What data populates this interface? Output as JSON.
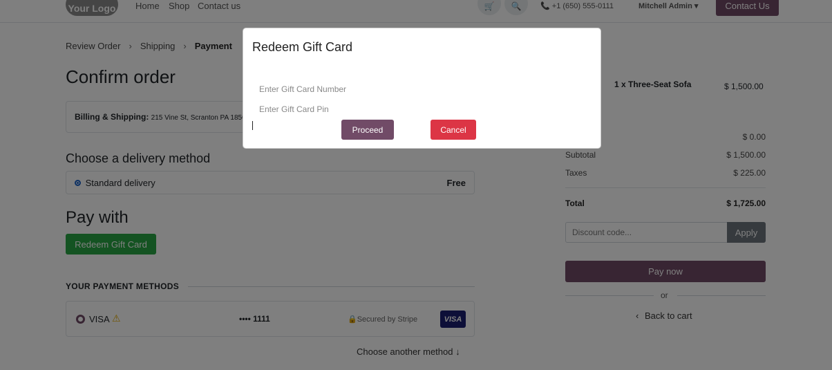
{
  "header": {
    "logo": "Your Logo",
    "nav": [
      "Home",
      "Shop",
      "Contact us"
    ],
    "phone": "+1 (650) 555-0111",
    "user": "Mitchell Admin",
    "contact_button": "Contact Us"
  },
  "breadcrumb": {
    "steps": [
      "Review Order",
      "Shipping",
      "Payment"
    ],
    "active": "Payment"
  },
  "main": {
    "title": "Confirm order",
    "billing_label": "Billing & Shipping:",
    "billing_address": "215 Vine St, Scranton PA 1850",
    "delivery_title": "Choose a delivery method",
    "delivery_option": "Standard delivery",
    "delivery_price": "Free",
    "pay_title": "Pay with",
    "gift_button": "Redeem Gift Card",
    "payment_methods_title": "YOUR PAYMENT METHODS",
    "payment_method": {
      "name": "VISA",
      "digits": "•••• 1111",
      "secured": "Secured by Stripe",
      "card_logo": "VISA"
    },
    "another_method": "Choose another method"
  },
  "summary": {
    "product": "1 x Three-Seat Sofa",
    "product_price": "$ 1,500.00",
    "delivery_value": "$ 0.00",
    "subtotal_label": "Subtotal",
    "subtotal": "$ 1,500.00",
    "taxes_label": "Taxes",
    "taxes": "$ 225.00",
    "total_label": "Total",
    "total": "$ 1,725.00",
    "discount_placeholder": "Discount code...",
    "apply_button": "Apply",
    "pay_button": "Pay now",
    "or": "or",
    "back_link": "Back to cart"
  },
  "modal": {
    "title": "Redeem Gift Card",
    "number_placeholder": "Enter Gift Card Number",
    "pin_placeholder": "Enter Gift Card Pin",
    "proceed": "Proceed",
    "cancel": "Cancel"
  },
  "colors": {
    "brand": "#714b67",
    "success": "#28a745",
    "danger": "#dc3545"
  }
}
